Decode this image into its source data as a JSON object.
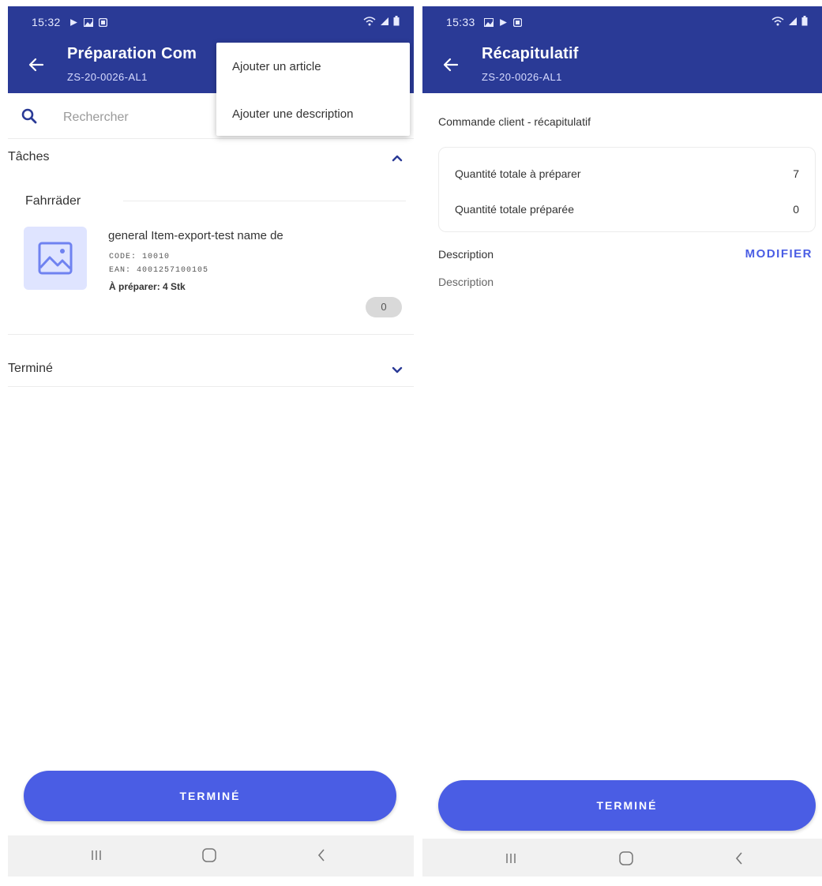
{
  "colors": {
    "primary": "#2a3a96",
    "accent": "#4a5de4",
    "image_placeholder_bg": "#dfe4ff",
    "badge_bg": "#d9d9d9"
  },
  "left": {
    "status": {
      "time": "15:32"
    },
    "header": {
      "title": "Préparation Com",
      "subtitle": "ZS-20-0026-AL1"
    },
    "menu": {
      "items": [
        "Ajouter un article",
        "Ajouter une description"
      ]
    },
    "search": {
      "placeholder": "Rechercher",
      "icon": "search-icon"
    },
    "sections": {
      "tasks": {
        "label": "Tâches",
        "expanded": true
      },
      "done": {
        "label": "Terminé",
        "expanded": false
      }
    },
    "group": {
      "label": "Fahrräder"
    },
    "item": {
      "name": "general Item-export-test name de",
      "code": "CODE: 10010",
      "ean": "EAN: 4001257100105",
      "to_prepare": "À préparer: 4 Stk",
      "quantity": "0",
      "image_icon": "image-placeholder-icon"
    },
    "primary_button": "TERMINÉ"
  },
  "right": {
    "status": {
      "time": "15:33"
    },
    "header": {
      "title": "Récapitulatif",
      "subtitle": "ZS-20-0026-AL1"
    },
    "summary": {
      "heading": "Commande client - récapitulatif",
      "rows": [
        {
          "label": "Quantité totale à préparer",
          "value": "7"
        },
        {
          "label": "Quantité totale préparée",
          "value": "0"
        }
      ]
    },
    "description": {
      "label": "Description",
      "action": "MODIFIER",
      "value": "Description"
    },
    "primary_button": "TERMINÉ"
  }
}
